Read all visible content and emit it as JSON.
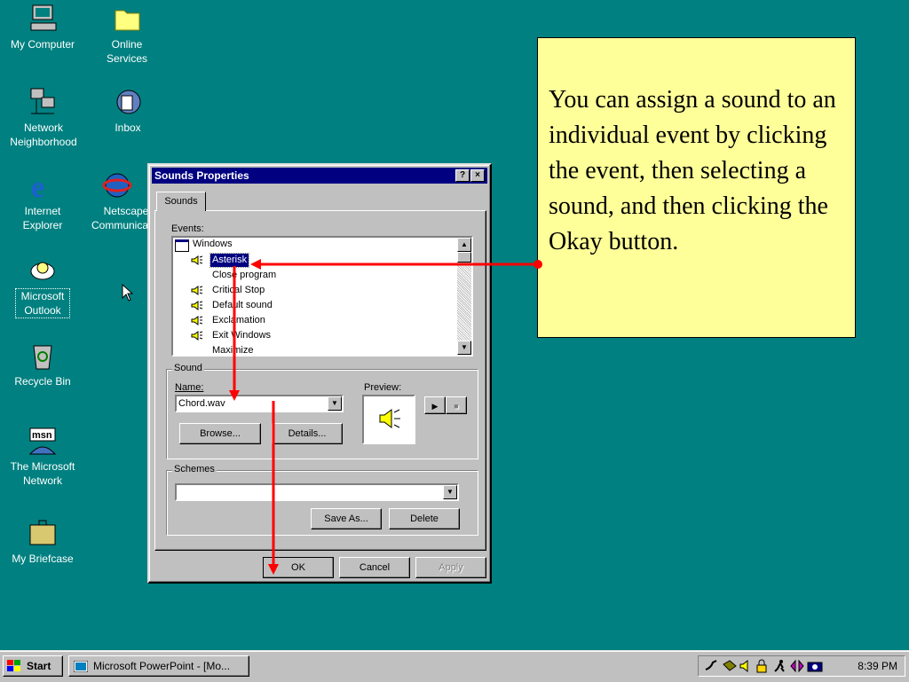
{
  "desktop": {
    "icons": [
      {
        "label": "My Computer"
      },
      {
        "label": "Online Services"
      },
      {
        "label": "Network Neighborhood"
      },
      {
        "label": "Inbox"
      },
      {
        "label": "Internet Explorer"
      },
      {
        "label": "Netscape Communicator"
      },
      {
        "label": "Microsoft Outlook"
      },
      {
        "label": "Recycle Bin"
      },
      {
        "label": "The Microsoft Network"
      },
      {
        "label": "My Briefcase"
      }
    ]
  },
  "window": {
    "title": "Sounds Properties",
    "help_btn": "?",
    "close_btn": "×",
    "tab": "Sounds",
    "events_label": "Events:",
    "events_root": "Windows",
    "events": [
      "Asterisk",
      "Close program",
      "Critical Stop",
      "Default sound",
      "Exclamation",
      "Exit Windows",
      "Maximize"
    ],
    "selected_event": "Asterisk",
    "sound_group": "Sound",
    "name_label": "Name:",
    "name_value": "Chord.wav",
    "preview_label": "Preview:",
    "browse_btn": "Browse...",
    "details_btn": "Details...",
    "schemes_group": "Schemes",
    "schemes_value": "",
    "save_as_btn": "Save As...",
    "delete_btn": "Delete",
    "ok_btn": "OK",
    "cancel_btn": "Cancel",
    "apply_btn": "Apply"
  },
  "annotation": {
    "text": "You can assign a sound to an individual event by clicking the event, then selecting a sound, and then clicking the Okay button.",
    "arrow_color": "#ff0000"
  },
  "taskbar": {
    "start": "Start",
    "task": "Microsoft PowerPoint - [Mo...",
    "clock": "8:39 PM"
  },
  "colors": {
    "desktop": "#008080",
    "titlebar": "#000080",
    "note": "#ffff99"
  }
}
